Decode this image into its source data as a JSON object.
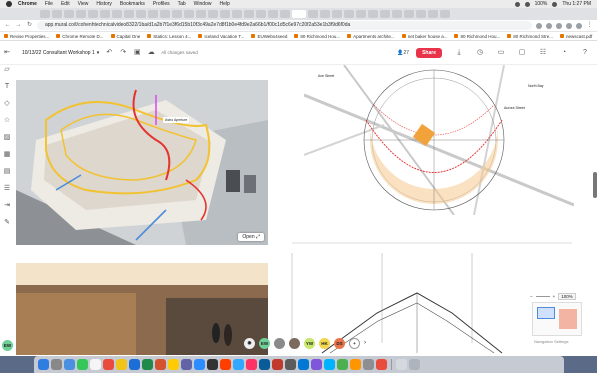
{
  "menubar": {
    "app": "Chrome",
    "items": [
      "File",
      "Edit",
      "View",
      "History",
      "Bookmarks",
      "Profiles",
      "Tab",
      "Window",
      "Help"
    ],
    "battery": "100%",
    "clock": "Thu 1:27 PM"
  },
  "browser": {
    "url": "app.mural.co/t/cohenhtechnicalvideo8322/1ba/d1a2b7f1e3f6d15b10f3c49a2e7d8f1b0e4fd9e2a66b1/f00c1d5c6e97c20f2a53e1b3f9d6f0da",
    "bookmarks": [
      "Revise Properties...",
      "Chrome Remote D...",
      "Capital One",
      "Statics: Lesson 4...",
      "Iceland Vacation T...",
      "EUWebs4seed",
      "80 Richmond Hou...",
      "Apartments archite...",
      "net baker house a...",
      "80 Richmond Hou...",
      "80 Richmond Stre...",
      "newscast.pdf"
    ]
  },
  "toolbar": {
    "board_title": "10/13/22 Consultant Workshop 1",
    "chevron": "▾",
    "saved_text": "All changes saved",
    "share_label": "Share",
    "member_count": "27"
  },
  "canvas": {
    "render_label": "Astro Aperture",
    "open_label": "Open",
    "sun_path_labels": [
      "Ave Street",
      "North Bay",
      "Aurora Street"
    ]
  },
  "collaborators": [
    {
      "initials": "EW",
      "color": "#6fcf97"
    },
    {
      "initials": "",
      "color": "#8a8a8a"
    },
    {
      "initials": "",
      "color": "#7b6a5d"
    },
    {
      "initials": "YW",
      "color": "#c6e66d"
    },
    {
      "initials": "HK",
      "color": "#f2d64b"
    },
    {
      "initials": "DS",
      "color": "#e8744a"
    }
  ],
  "zoom": {
    "value": "100%",
    "minus": "−",
    "plus": "+"
  },
  "nav_settings": "Navigation Settings",
  "bottom_avatar": "EW",
  "colors": {
    "share": "#e8334a",
    "sun_ring": "#e83a3a",
    "sun_fill": "#f4c88e"
  }
}
